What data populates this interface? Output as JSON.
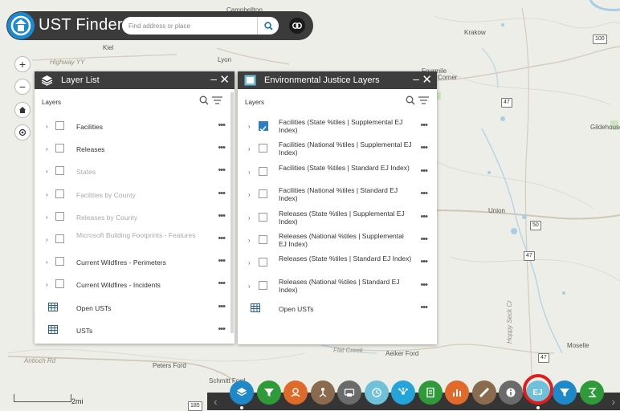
{
  "app": {
    "title": "UST Finder"
  },
  "search": {
    "placeholder": "Find address or place"
  },
  "map": {
    "labels": [
      {
        "text": "Campbellton",
        "kind": "town"
      },
      {
        "text": "Kiel",
        "kind": "town"
      },
      {
        "text": "Lyon",
        "kind": "town"
      },
      {
        "text": "Krakow",
        "kind": "town"
      },
      {
        "text": "Gildehouse",
        "kind": "town"
      },
      {
        "text": "Union",
        "kind": "town"
      },
      {
        "text": "Moselle",
        "kind": "town"
      },
      {
        "text": "Aeiker Ford",
        "kind": "town"
      },
      {
        "text": "Peters Ford",
        "kind": "town"
      },
      {
        "text": "Schmitt Ford",
        "kind": "town"
      },
      {
        "text": "Antioch Rd",
        "kind": "road"
      },
      {
        "text": "Highway YY",
        "kind": "road"
      },
      {
        "text": "Fourmile",
        "kind": "town"
      },
      {
        "text": "Corner",
        "kind": "town"
      },
      {
        "text": "Hoppy Seck Cr",
        "kind": "road"
      },
      {
        "text": "Flat Creek",
        "kind": "road"
      }
    ],
    "shields": [
      "100",
      "47",
      "50",
      "47",
      "47",
      "185"
    ],
    "scale_label": "2mi"
  },
  "layer_list": {
    "title": "Layer List",
    "section_label": "Layers",
    "items": [
      {
        "label": "Facilities",
        "type": "group",
        "dim": false
      },
      {
        "label": "Releases",
        "type": "group",
        "dim": false
      },
      {
        "label": "States",
        "type": "group",
        "dim": true
      },
      {
        "label": "Facilities by County",
        "type": "group",
        "dim": true
      },
      {
        "label": "Releases by County",
        "type": "group",
        "dim": true
      },
      {
        "label": "Microsoft Building Footprints - Features",
        "type": "group",
        "dim": true
      },
      {
        "label": "Current Wildfires - Perimeters",
        "type": "group",
        "dim": false
      },
      {
        "label": "Current Wildfires - Incidents",
        "type": "group",
        "dim": false
      },
      {
        "label": "Open USTs",
        "type": "table",
        "dim": false
      },
      {
        "label": "USTs",
        "type": "table",
        "dim": false
      }
    ]
  },
  "ej_layers": {
    "title": "Environmental Justice Layers",
    "section_label": "Layers",
    "items": [
      {
        "label": "Facilities (State %tiles | Supplemental EJ Index)",
        "type": "group",
        "checked": true
      },
      {
        "label": "Facilities (National %tiles | Supplemental EJ Index)",
        "type": "group",
        "checked": false
      },
      {
        "label": "Facilities (State %tiles | Standard EJ Index)",
        "type": "group",
        "checked": false
      },
      {
        "label": "Facilities (National %tiles | Standard EJ Index)",
        "type": "group",
        "checked": false
      },
      {
        "label": "Releases (State %tiles | Supplemental EJ Index)",
        "type": "group",
        "checked": false
      },
      {
        "label": "Releases (National %tiles | Supplemental EJ Index)",
        "type": "group",
        "checked": false
      },
      {
        "label": "Releases (State %tiles | Standard EJ Index)",
        "type": "group",
        "checked": false
      },
      {
        "label": "Releases (National %tiles | Standard EJ Index)",
        "type": "group",
        "checked": false
      },
      {
        "label": "Open USTs",
        "type": "table",
        "checked": false
      }
    ]
  },
  "toolbar": {
    "widgets": [
      {
        "name": "layer-list-widget",
        "color": "#1e88c9",
        "icon": "layers-icon",
        "active": true
      },
      {
        "name": "filter-widget",
        "color": "#2f9a3a",
        "icon": "filter-icon",
        "active": false
      },
      {
        "name": "draw-widget",
        "color": "#e06a2a",
        "icon": "draw-icon",
        "active": false
      },
      {
        "name": "share-widget",
        "color": "#8a6b4d",
        "icon": "share-icon",
        "active": false
      },
      {
        "name": "print-widget",
        "color": "#6b6b6b",
        "icon": "print-icon",
        "active": false
      },
      {
        "name": "history-widget",
        "color": "#6fc1d9",
        "icon": "clock-icon",
        "active": false
      },
      {
        "name": "network-widget",
        "color": "#24a4d9",
        "icon": "network-icon",
        "active": false
      },
      {
        "name": "report-widget",
        "color": "#2f9a3a",
        "icon": "report-icon",
        "active": false
      },
      {
        "name": "chart-widget",
        "color": "#e06a2a",
        "icon": "chart-icon",
        "active": false
      },
      {
        "name": "measure-widget",
        "color": "#8a6b4d",
        "icon": "ruler-icon",
        "active": false
      },
      {
        "name": "info-widget",
        "color": "#6b6b6b",
        "icon": "info-icon",
        "active": false
      },
      {
        "name": "ej-widget",
        "color": "#6fc1d9",
        "icon": "ej-icon",
        "label": "EJ",
        "active": true
      },
      {
        "name": "filter-widget-2",
        "color": "#1e88c9",
        "icon": "filter-icon",
        "active": false
      },
      {
        "name": "summary-widget",
        "color": "#2f9a3a",
        "icon": "sigma-icon",
        "active": false
      }
    ]
  },
  "colors": {
    "header_bg": "#3b3b3b",
    "panel_header_bg": "#3d3d3d",
    "highlight_ring": "#e31b1b",
    "check_on": "#2c7fc3"
  }
}
